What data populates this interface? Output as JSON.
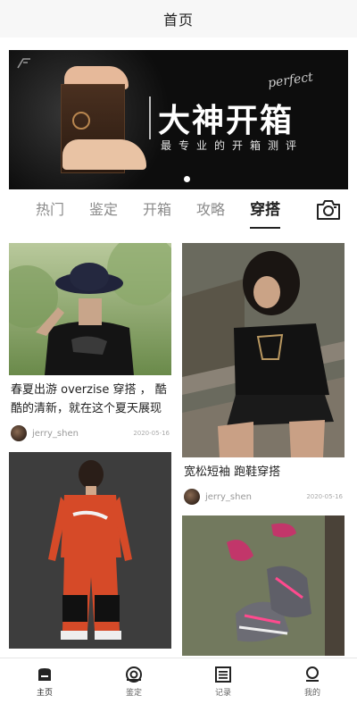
{
  "header": {
    "title": "首页"
  },
  "banner": {
    "title": "大神开箱",
    "subtitle": "最专业的开箱测评",
    "script_word": "perfect"
  },
  "tabs": [
    {
      "label": "热门",
      "active": false
    },
    {
      "label": "鉴定",
      "active": false
    },
    {
      "label": "开箱",
      "active": false
    },
    {
      "label": "攻略",
      "active": false
    },
    {
      "label": "穿搭",
      "active": true
    }
  ],
  "camera": {
    "icon": "camera-icon"
  },
  "feed": {
    "left": [
      {
        "title": "春夏出游 overzise 穿搭 ， 酷酷的清新，就在这个夏天展现",
        "user": "jerry_shen",
        "date": "2020-05-16"
      },
      {
        "title": "",
        "user": "",
        "date": ""
      }
    ],
    "right": [
      {
        "title": "宽松短袖 跑鞋穿搭",
        "user": "jerry_shen",
        "date": "2020-05-16"
      },
      {
        "title": "",
        "user": "",
        "date": ""
      }
    ]
  },
  "tabbar": [
    {
      "label": "主页",
      "icon": "home-icon",
      "active": true
    },
    {
      "label": "鉴定",
      "icon": "eye-icon",
      "active": false
    },
    {
      "label": "记录",
      "icon": "list-icon",
      "active": false
    },
    {
      "label": "我的",
      "icon": "user-icon",
      "active": false
    }
  ],
  "colors": {
    "accent": "#222222",
    "muted": "#8a8a8a",
    "banner_bg": "#0d0d0d"
  }
}
